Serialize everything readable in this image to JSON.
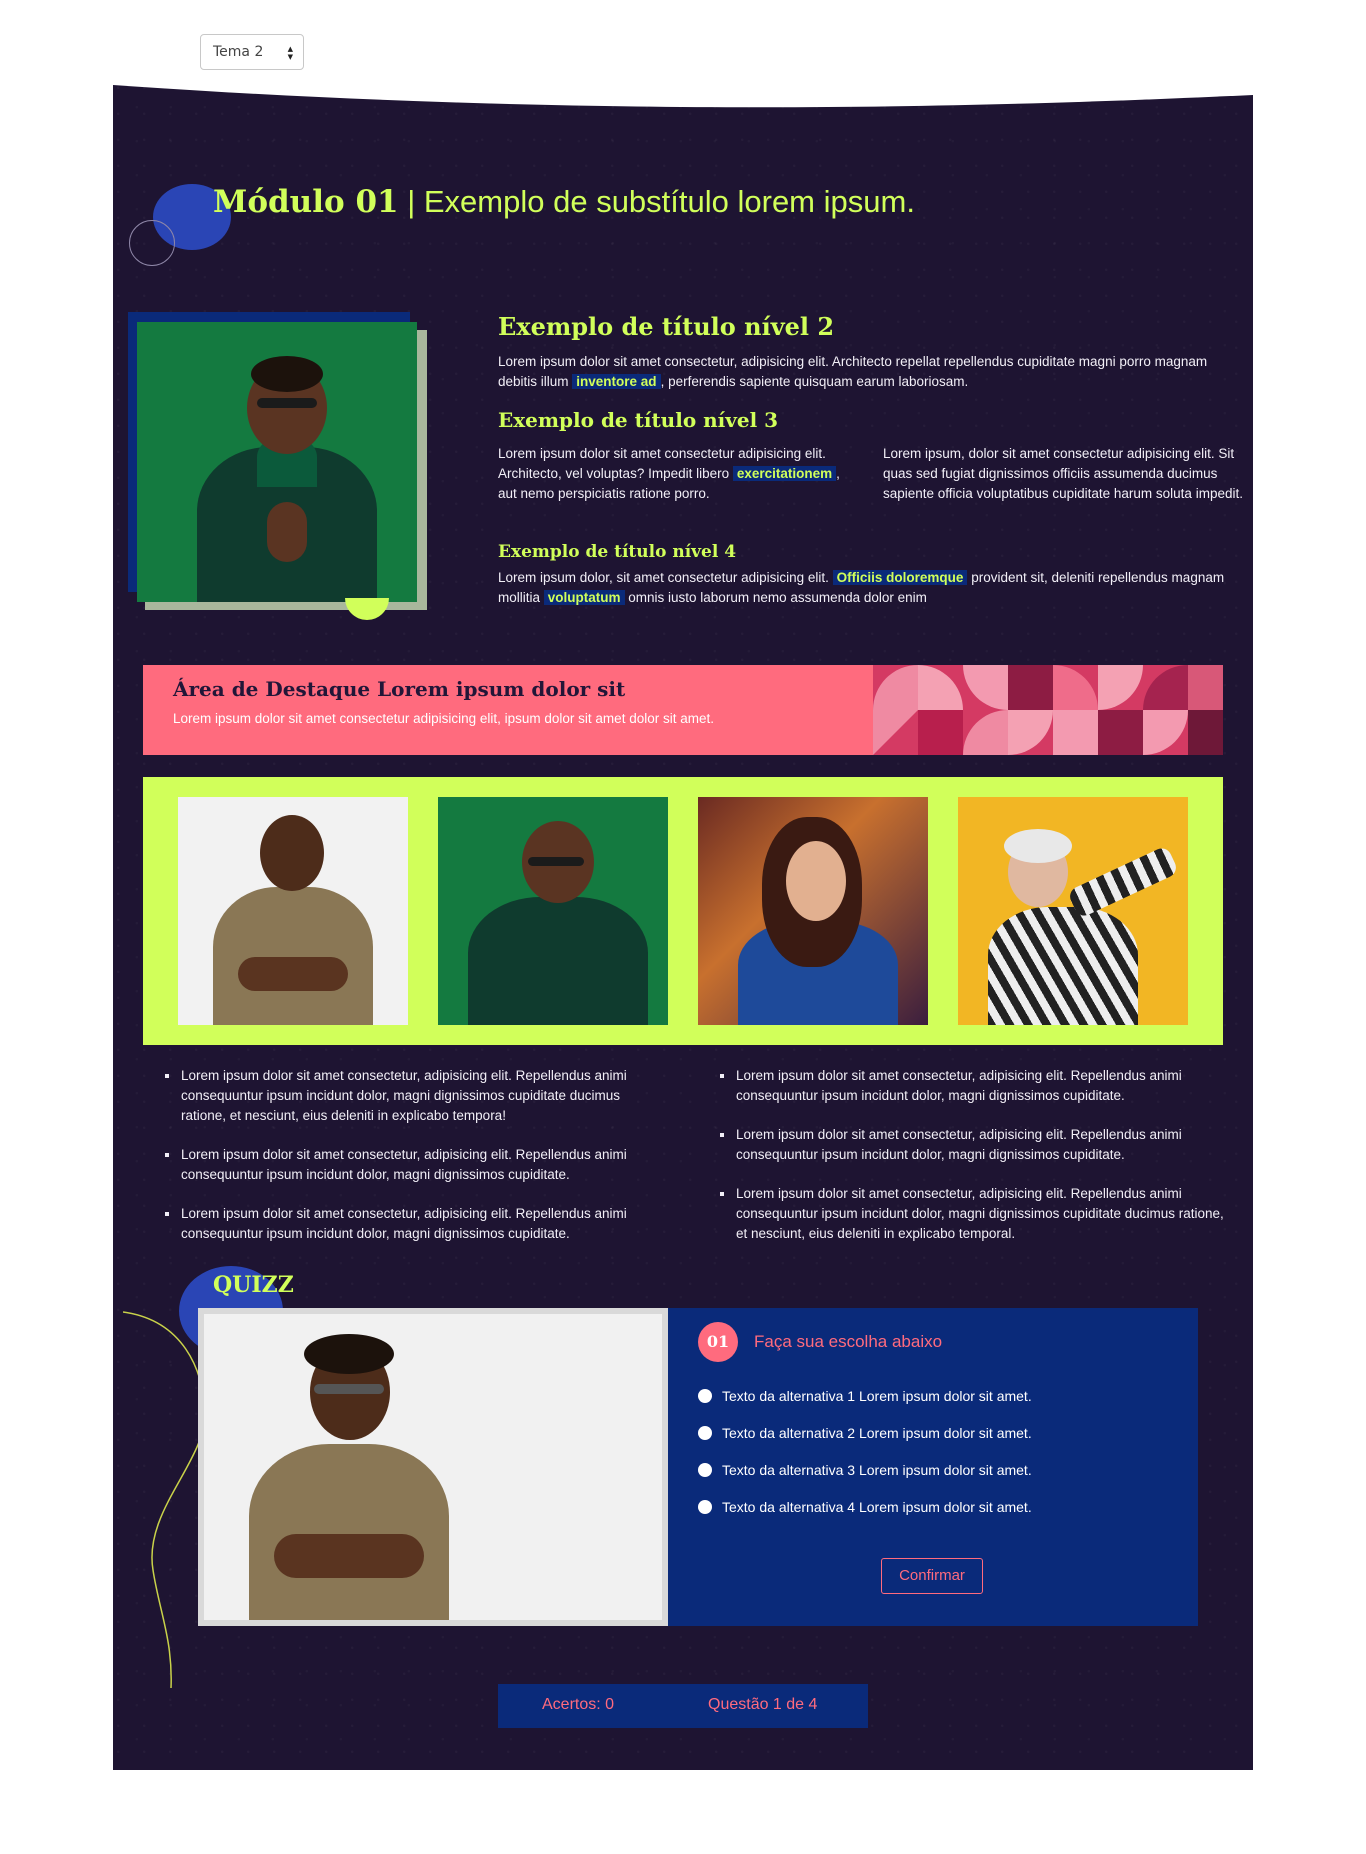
{
  "theme_select": {
    "value": "Tema 2"
  },
  "module": {
    "number": "Módulo 01",
    "separator": " | ",
    "subtitle": "Exemplo de substítulo lorem ipsum."
  },
  "content": {
    "h2": "Exemplo de título nível 2",
    "p1_a": "Lorem ipsum dolor sit amet consectetur, adipisicing elit. Architecto repellat repellendus cupiditate magni porro magnam debitis illum ",
    "p1_hl": "inventore ad",
    "p1_b": ", perferendis sapiente quisquam earum laboriosam.",
    "h3": "Exemplo de título nível 3",
    "p2_a": "Lorem ipsum dolor sit amet consectetur adipisicing elit. Architecto, vel voluptas? Impedit libero ",
    "p2_hl": "exercitationem",
    "p2_b": ", aut nemo perspiciatis ratione porro.",
    "p3": "Lorem ipsum, dolor sit amet consectetur adipisicing elit. Sit quas sed fugiat dignissimos officiis assumenda ducimus sapiente officia voluptatibus cupiditate harum soluta impedit.",
    "h4": "Exemplo de título nível 4",
    "p4_a": "Lorem ipsum dolor, sit amet consectetur adipisicing elit. ",
    "p4_hl1": "Officiis doloremque",
    "p4_b": " provident sit, deleniti repellendus magnam mollitia ",
    "p4_hl2": "voluptatum",
    "p4_c": " omnis iusto laborum nemo assumenda dolor enim"
  },
  "highlight": {
    "title": "Área de Destaque Lorem ipsum dolor sit",
    "text": "Lorem ipsum dolor sit amet consectetur adipisicing elit, ipsum dolor sit amet dolor sit amet."
  },
  "bullets_left": [
    "Lorem ipsum dolor sit amet consectetur, adipisicing elit. Repellendus animi consequuntur ipsum incidunt dolor, magni dignissimos cupiditate ducimus ratione, et nesciunt, eius deleniti in explicabo tempora!",
    "Lorem ipsum dolor sit amet consectetur, adipisicing elit. Repellendus animi consequuntur ipsum incidunt dolor, magni dignissimos cupiditate.",
    "Lorem ipsum dolor sit amet consectetur, adipisicing elit. Repellendus animi consequuntur ipsum incidunt dolor, magni dignissimos cupiditate."
  ],
  "bullets_right": [
    "Lorem ipsum dolor sit amet consectetur, adipisicing elit. Repellendus animi consequuntur ipsum incidunt dolor, magni dignissimos cupiditate.",
    "Lorem ipsum dolor sit amet consectetur, adipisicing elit. Repellendus animi consequuntur ipsum incidunt dolor, magni dignissimos cupiditate.",
    "Lorem ipsum dolor sit amet consectetur, adipisicing elit. Repellendus animi consequuntur ipsum incidunt dolor, magni dignissimos cupiditate ducimus ratione, et nesciunt, eius deleniti in explicabo temporal."
  ],
  "quiz": {
    "title": "QUIZZ",
    "question_number": "01",
    "prompt": "Faça sua escolha abaixo",
    "options": [
      "Texto da alternativa 1 Lorem ipsum dolor sit amet.",
      "Texto da alternativa 2 Lorem ipsum dolor sit amet.",
      "Texto da alternativa 3 Lorem ipsum dolor sit amet.",
      "Texto da alternativa 4 Lorem ipsum dolor sit amet."
    ],
    "confirm_label": "Confirmar",
    "score": "Acertos: 0",
    "progress": "Questão 1 de 4"
  },
  "colors": {
    "background": "#1e1432",
    "accent_lime": "#d1ff5a",
    "accent_pink": "#ff6b7e",
    "navy": "#0a2a7a"
  }
}
